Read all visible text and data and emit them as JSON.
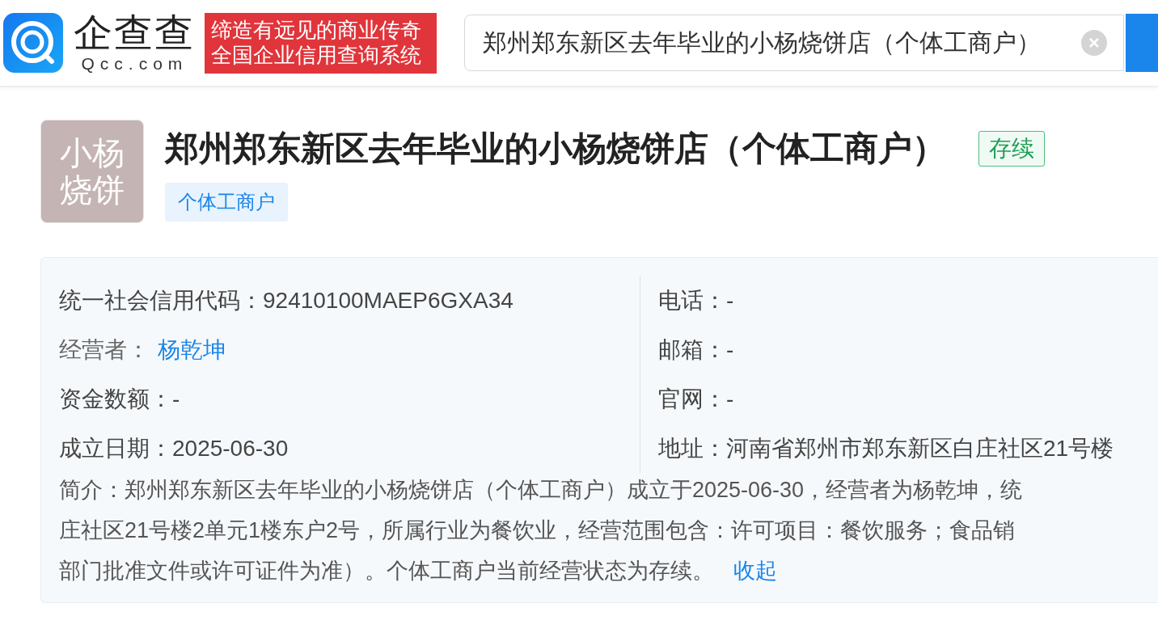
{
  "header": {
    "logo_text": "企查查",
    "logo_domain": "Qcc.com",
    "slogan": [
      "缔造有远见的商业传奇",
      "全国企业信用查询系统"
    ],
    "search": {
      "value": "郑州郑东新区去年毕业的小杨烧饼店（个体工商户）"
    }
  },
  "company": {
    "avatar": [
      "小杨",
      "烧饼"
    ],
    "name": "郑州郑东新区去年毕业的小杨烧饼店（个体工商户）",
    "status": "存续",
    "tags": [
      "个体工商户"
    ]
  },
  "info": {
    "left": [
      {
        "kind": "text",
        "text": "统一社会信用代码：92410100MAEP6GXA34"
      },
      {
        "kind": "link",
        "label": "经营者：",
        "value": "杨乾坤"
      },
      {
        "kind": "text",
        "text": "资金数额：-"
      },
      {
        "kind": "text",
        "text": "成立日期：2025-06-30"
      }
    ],
    "right": [
      {
        "kind": "text",
        "text": "电话：-"
      },
      {
        "kind": "text",
        "text": "邮箱：-"
      },
      {
        "kind": "text",
        "text": "官网：-"
      },
      {
        "kind": "text",
        "text": "地址：河南省郑州市郑东新区白庄社区21号楼"
      }
    ],
    "intro": [
      "简介：郑州郑东新区去年毕业的小杨烧饼店（个体工商户）成立于2025-06-30，经营者为杨乾坤，统",
      "庄社区21号楼2单元1楼东户2号，所属行业为餐饮业，经营范围包含：许可项目：餐饮服务；食品销",
      "部门批准文件或许可证件为准）。个体工商户当前经营状态为存续。"
    ],
    "collapse_link": "收起"
  }
}
